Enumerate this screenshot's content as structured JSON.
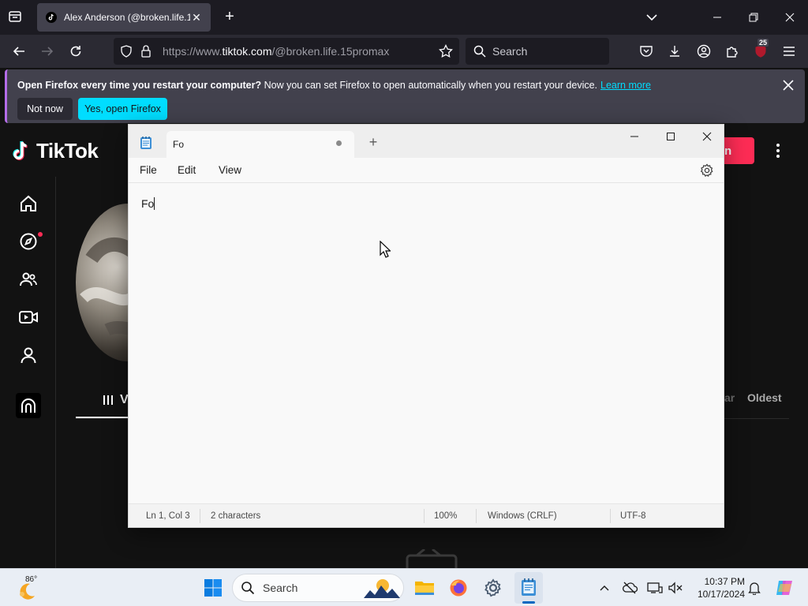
{
  "browser": {
    "tab_title": "Alex Anderson (@broken.life.15",
    "url_prefix": "https://www.",
    "url_domain": "tiktok.com",
    "url_path": "/@broken.life.15promax",
    "search_placeholder": "Search",
    "extension_badge": "25"
  },
  "notification": {
    "bold_text": "Open Firefox every time you restart your computer?",
    "text": " Now you can set Firefox to open automatically when you restart your device.",
    "link": "Learn more",
    "not_now": "Not now",
    "yes_button": "Yes, open Firefox",
    "accent_color": "#00ddff"
  },
  "tiktok": {
    "logo_text": "TikTok",
    "login_partial": "n",
    "videos_tab_partial": "V",
    "sort_partial": "ar",
    "sort_oldest": "Oldest",
    "sidebar_icons": [
      "home-icon",
      "explore-icon",
      "following-icon",
      "live-icon",
      "profile-icon",
      "more-icon"
    ]
  },
  "notepad": {
    "tab_title": "Fo",
    "menu": {
      "file": "File",
      "edit": "Edit",
      "view": "View"
    },
    "content": "Fo",
    "status": {
      "position": "Ln 1, Col 3",
      "chars": "2 characters",
      "zoom": "100%",
      "line_ending": "Windows (CRLF)",
      "encoding": "UTF-8"
    }
  },
  "taskbar": {
    "weather_temp": "86°",
    "search_label": "Search",
    "time": "10:37 PM",
    "date": "10/17/2024"
  }
}
